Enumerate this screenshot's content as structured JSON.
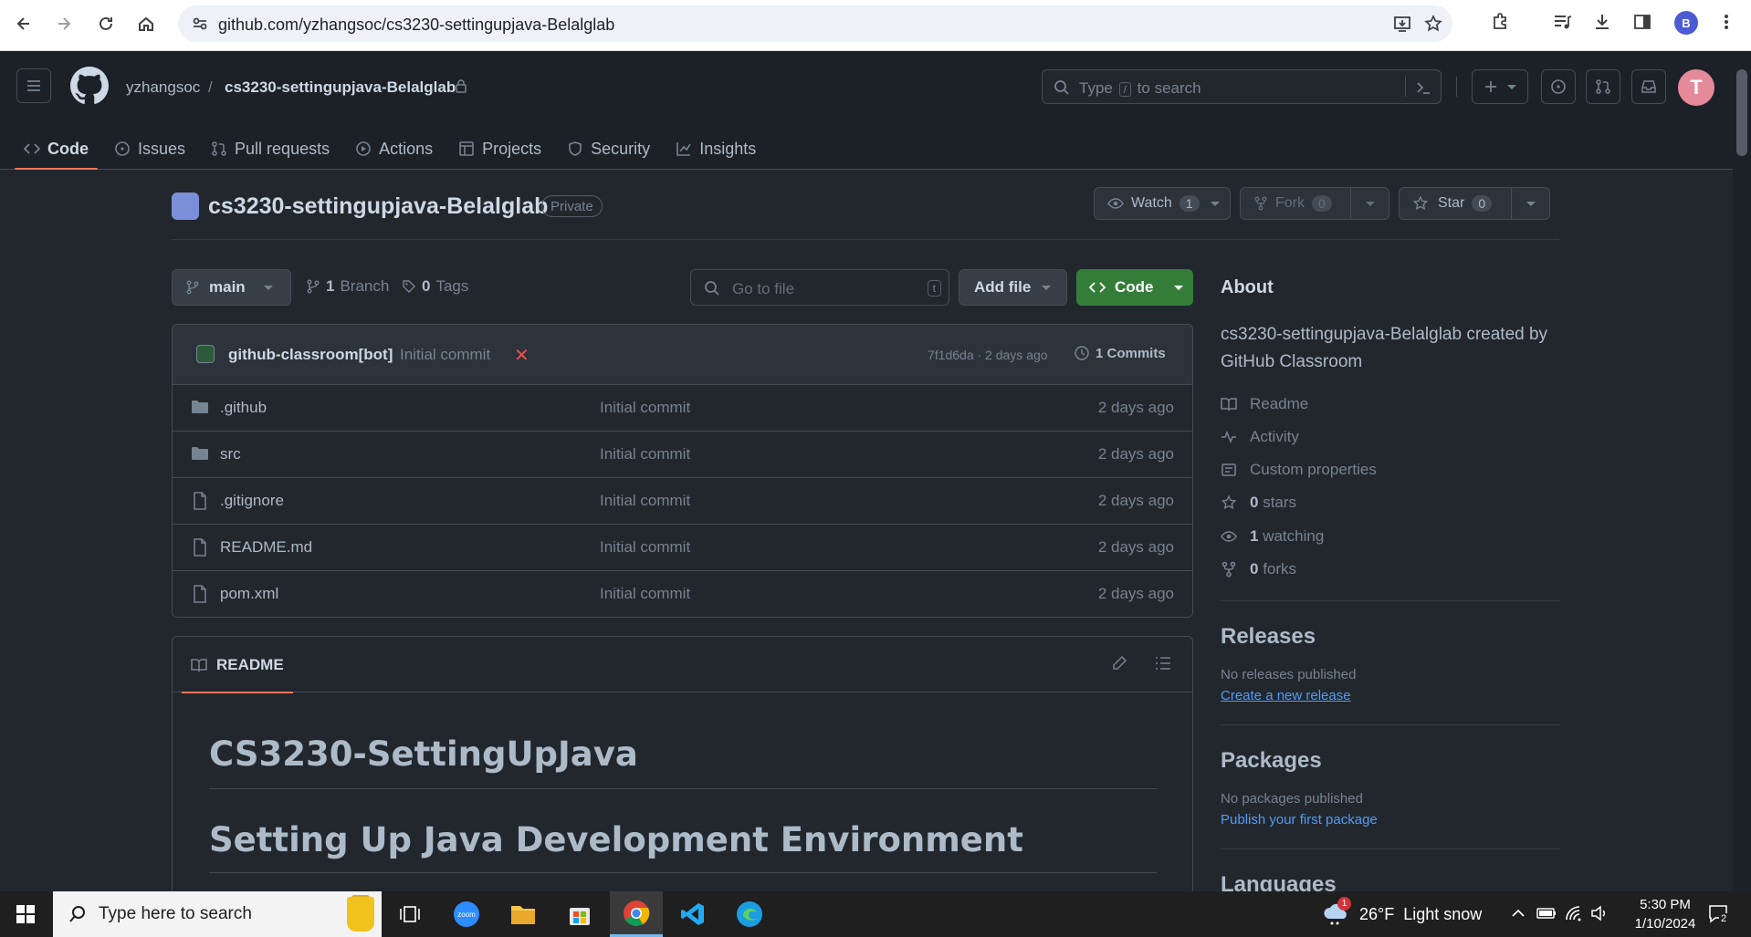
{
  "browser": {
    "url": "github.com/yzhangsoc/cs3230-settingupjava-Belalglab",
    "profile_initial": "B"
  },
  "header": {
    "owner": "yzhangsoc",
    "separator": "/",
    "repo": "cs3230-settingupjava-Belalglab",
    "search_placeholder_pre": "Type",
    "search_placeholder_key": "/",
    "search_placeholder_post": "to search",
    "avatar_letter": "T"
  },
  "tabs": [
    {
      "label": "Code",
      "icon": "code-icon"
    },
    {
      "label": "Issues",
      "icon": "issue-icon"
    },
    {
      "label": "Pull requests",
      "icon": "pull-request-icon"
    },
    {
      "label": "Actions",
      "icon": "play-icon"
    },
    {
      "label": "Projects",
      "icon": "table-icon"
    },
    {
      "label": "Security",
      "icon": "shield-icon"
    },
    {
      "label": "Insights",
      "icon": "graph-icon"
    }
  ],
  "repo": {
    "title": "cs3230-settingupjava-Belalglab",
    "visibility": "Private",
    "watch_label": "Watch",
    "watch_count": "1",
    "fork_label": "Fork",
    "fork_count": "0",
    "star_label": "Star",
    "star_count": "0"
  },
  "branch": {
    "name": "main",
    "branches_count": "1",
    "branches_label": "Branch",
    "tags_count": "0",
    "tags_label": "Tags",
    "goto_placeholder": "Go to file",
    "goto_key": "t",
    "add_file_label": "Add file",
    "code_label": "Code"
  },
  "latest_commit": {
    "author": "github-classroom[bot]",
    "message": "Initial commit",
    "status": "✕",
    "hash_and_time": "7f1d6da · 2 days ago",
    "commits_label": "1 Commits"
  },
  "files": [
    {
      "name": ".github",
      "type": "folder",
      "message": "Initial commit",
      "date": "2 days ago"
    },
    {
      "name": "src",
      "type": "folder",
      "message": "Initial commit",
      "date": "2 days ago"
    },
    {
      "name": ".gitignore",
      "type": "file",
      "message": "Initial commit",
      "date": "2 days ago"
    },
    {
      "name": "README.md",
      "type": "file",
      "message": "Initial commit",
      "date": "2 days ago"
    },
    {
      "name": "pom.xml",
      "type": "file",
      "message": "Initial commit",
      "date": "2 days ago"
    }
  ],
  "readme": {
    "tab_label": "README",
    "h1": "CS3230-SettingUpJava",
    "h2": "Setting Up Java Development Environment"
  },
  "sidebar": {
    "about_title": "About",
    "about_desc": "cs3230-settingupjava-Belalglab created by GitHub Classroom",
    "items": [
      {
        "icon": "book-icon",
        "label": "Readme",
        "bold": ""
      },
      {
        "icon": "pulse-icon",
        "label": "Activity",
        "bold": ""
      },
      {
        "icon": "note-icon",
        "label": "Custom properties",
        "bold": ""
      },
      {
        "icon": "star-icon",
        "label": "stars",
        "bold": "0"
      },
      {
        "icon": "eye-icon",
        "label": "watching",
        "bold": "1"
      },
      {
        "icon": "fork-icon",
        "label": "forks",
        "bold": "0"
      }
    ],
    "releases_title": "Releases",
    "releases_none": "No releases published",
    "releases_link": "Create a new release",
    "packages_title": "Packages",
    "packages_none": "No packages published",
    "packages_link": "Publish your first package",
    "languages_title": "Languages"
  },
  "taskbar": {
    "search_placeholder": "Type here to search",
    "weather_temp": "26°F",
    "weather_text": "Light snow",
    "weather_badge": "1",
    "time": "5:30 PM",
    "date": "1/10/2024",
    "notif_count": "2"
  },
  "colors": {
    "bg": "#22272e",
    "header_bg": "#1c2128",
    "accent_tab": "#ec775c",
    "code_btn": "#347d39",
    "link": "#539bf5"
  }
}
